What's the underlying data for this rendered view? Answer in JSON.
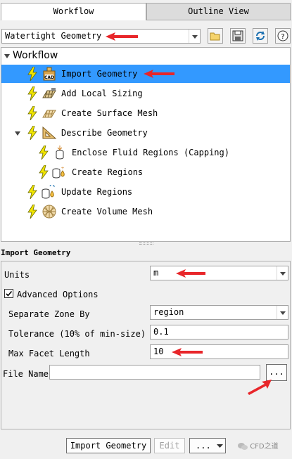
{
  "tabs": [
    {
      "label": "Workflow",
      "active": true
    },
    {
      "label": "Outline View",
      "active": false
    }
  ],
  "toolbar": {
    "workflow_select": "Watertight Geometry",
    "icons": [
      "folder-open-icon",
      "save-icon",
      "refresh-icon",
      "help-icon"
    ],
    "help_glyph": "?"
  },
  "tree": {
    "header": "Workflow",
    "items": [
      {
        "label": "Import Geometry",
        "icon": "cad-import-icon",
        "selected": true
      },
      {
        "label": "Add Local Sizing",
        "icon": "local-sizing-icon"
      },
      {
        "label": "Create Surface Mesh",
        "icon": "surface-mesh-icon"
      },
      {
        "label": "Describe Geometry",
        "icon": "describe-geometry-icon",
        "expanded": true
      },
      {
        "label": "Enclose Fluid Regions (Capping)",
        "icon": "capping-icon"
      },
      {
        "label": "Create Regions",
        "icon": "create-regions-icon"
      },
      {
        "label": "Update Regions",
        "icon": "update-regions-icon"
      },
      {
        "label": "Create Volume Mesh",
        "icon": "volume-mesh-icon"
      }
    ]
  },
  "panel": {
    "title": "Import Geometry",
    "units_label": "Units",
    "units_value": "m",
    "advanced_label": "Advanced Options",
    "advanced_checked": true,
    "separate_label": "Separate Zone By",
    "separate_value": "region",
    "tolerance_label": "Tolerance (10% of min-size)",
    "tolerance_value": "0.1",
    "max_facet_label": "Max Facet Length",
    "max_facet_value": "10",
    "file_name_label": "File Name",
    "file_name_value": "",
    "browse_label": "..."
  },
  "footer": {
    "import_label": "Import Geometry",
    "edit_label": "Edit",
    "more_label": "..."
  },
  "watermark": "CFD之道",
  "colors": {
    "selection": "#3399ff",
    "bolt": "#f2e600",
    "arrow": "#e8262a"
  }
}
